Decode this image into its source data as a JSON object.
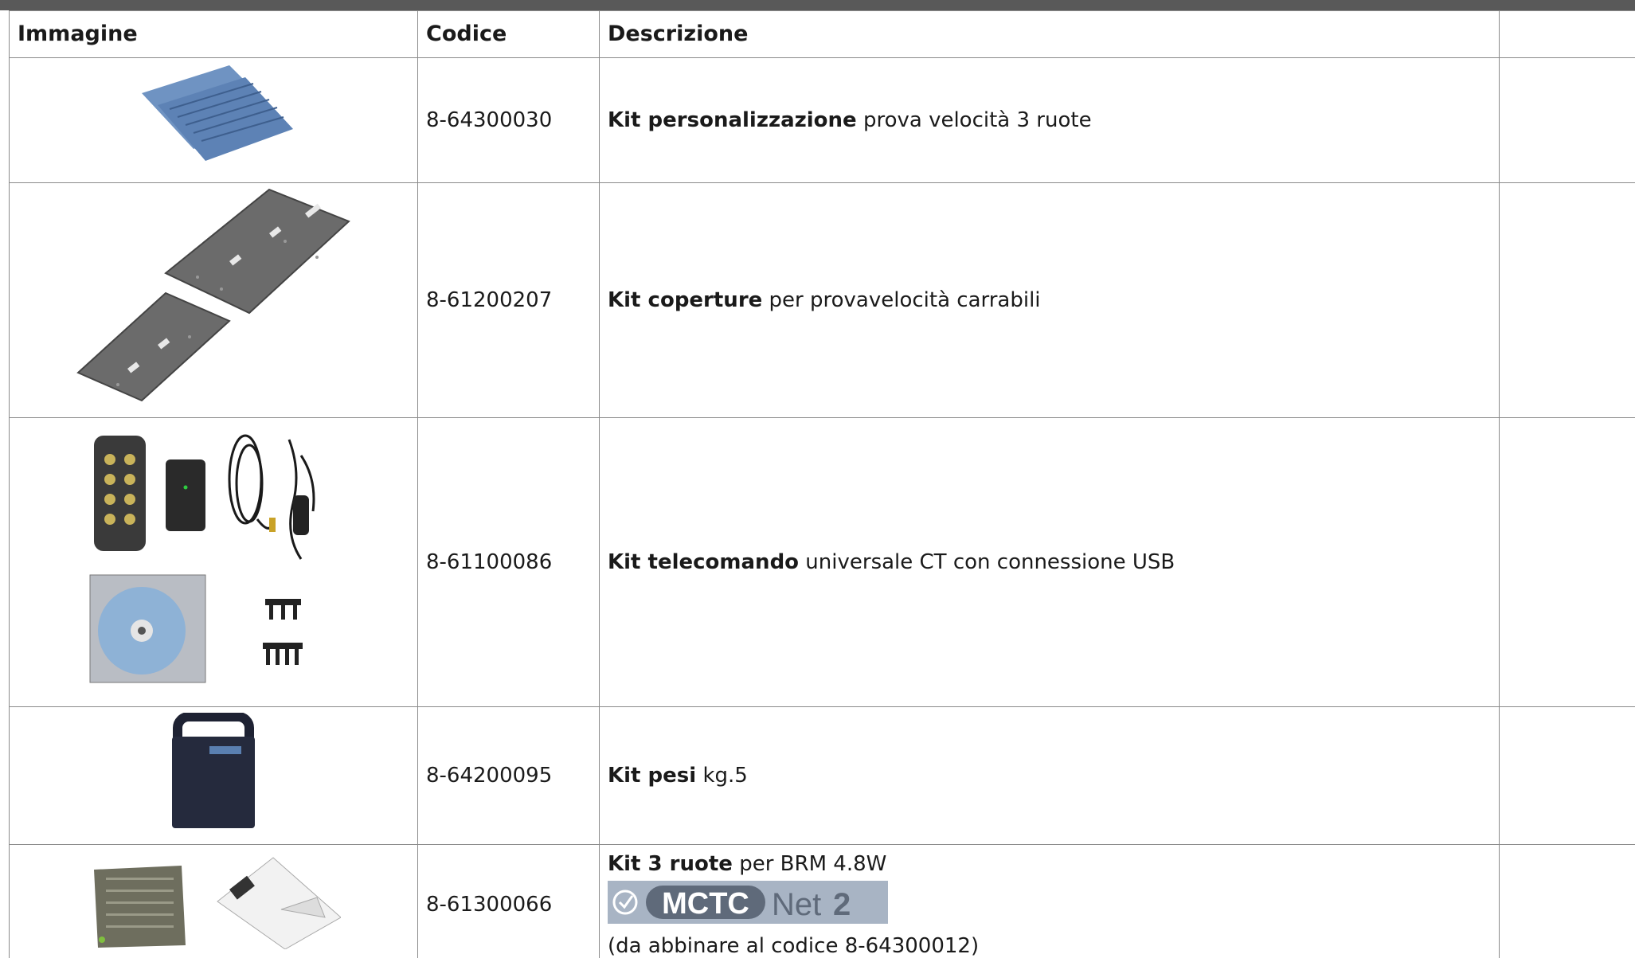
{
  "table": {
    "headers": {
      "image": "Immagine",
      "code": "Codice",
      "description": "Descrizione",
      "extra": ""
    },
    "rows": [
      {
        "code": "8-64300030",
        "desc_bold": "Kit personalizzazione",
        "desc_rest": " prova velocità 3 ruote",
        "image_icon": "blue-rubber-mats-image"
      },
      {
        "code": "8-61200207",
        "desc_bold": "Kit coperture",
        "desc_rest": " per provavelocità carrabili",
        "image_icon": "metal-cover-plates-image"
      },
      {
        "code": "8-61100086",
        "desc_bold": "Kit telecomando",
        "desc_rest": " universale CT con connessione USB",
        "image_icon": "remote-control-kit-image"
      },
      {
        "code": "8-64200095",
        "desc_bold": "Kit pesi",
        "desc_rest": " kg.5",
        "image_icon": "weight-case-image"
      },
      {
        "code": "8-61300066",
        "desc_bold": "Kit 3 ruote",
        "desc_rest": " per BRM 4.8W",
        "logo_mctc": "MCTC",
        "logo_net": "Net",
        "logo_num": "2",
        "desc_note": "(da abbinare al codice 8-64300012)",
        "image_icon": "three-wheel-kit-image"
      }
    ]
  },
  "colors": {
    "topbar": "#595959",
    "border": "#8a8a8a",
    "logo_bg": "#a8b4c4"
  }
}
